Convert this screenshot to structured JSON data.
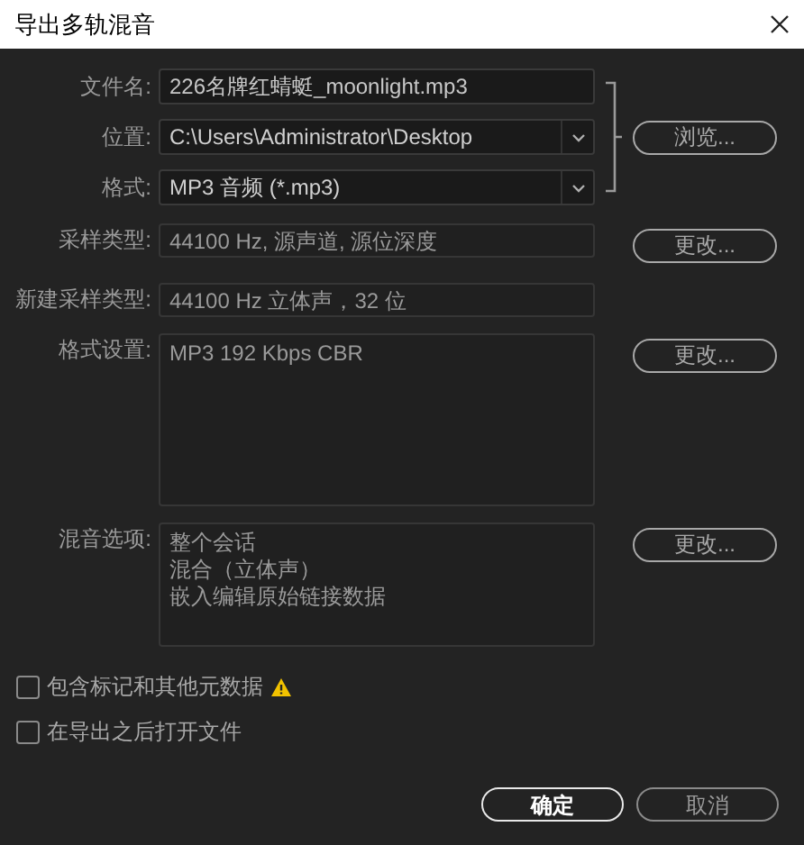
{
  "window": {
    "title": "导出多轨混音"
  },
  "file_group": {
    "rows": [
      {
        "label": "文件名:",
        "kind": "input",
        "value": "226名牌红蜻蜓_moonlight.mp3"
      },
      {
        "label": "位置:",
        "kind": "dropdown",
        "value": "C:\\Users\\Administrator\\Desktop"
      },
      {
        "label": "格式:",
        "kind": "dropdown",
        "value": "MP3 音频 (*.mp3)"
      }
    ],
    "button": "浏览..."
  },
  "settings": [
    {
      "label": "采样类型:",
      "kind": "readonly",
      "lines": [
        "44100 Hz, 源声道, 源位深度"
      ],
      "button": "更改..."
    },
    {
      "label": "新建采样类型:",
      "kind": "readonly",
      "lines": [
        "44100 Hz 立体声，32 位"
      ]
    },
    {
      "label": "格式设置:",
      "kind": "area",
      "lines": [
        "MP3 192 Kbps CBR"
      ],
      "button": "更改..."
    },
    {
      "label": "混音选项:",
      "kind": "list",
      "lines": [
        "整个会话",
        "混合（立体声）",
        "嵌入编辑原始链接数据"
      ],
      "button": "更改..."
    }
  ],
  "options": [
    {
      "label": "包含标记和其他元数据",
      "checked": false,
      "warning": true
    },
    {
      "label": "在导出之后打开文件",
      "checked": false,
      "warning": false
    }
  ],
  "buttons": [
    {
      "label": "确定",
      "default": true
    },
    {
      "label": "取消",
      "default": false
    }
  ]
}
